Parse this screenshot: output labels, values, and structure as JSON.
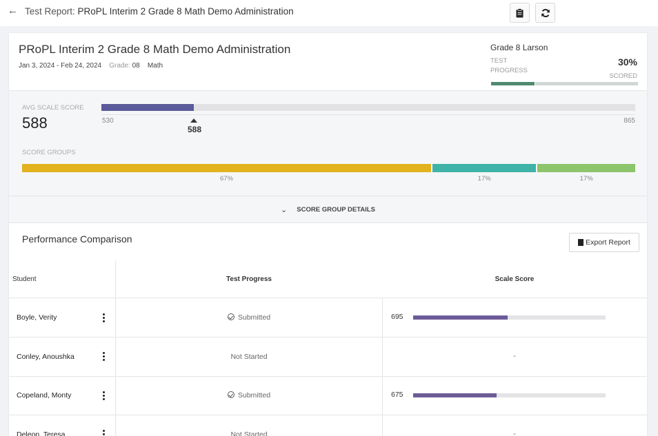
{
  "topbar": {
    "back_icon": "arrow-left-icon",
    "title_prefix": "Test Report:",
    "title_name": "PRoPL Interim 2 Grade 8 Math Demo Administration",
    "actions": [
      {
        "icon": "clipboard-icon"
      },
      {
        "icon": "refresh-icon"
      }
    ]
  },
  "header": {
    "title": "PRoPL Interim 2 Grade 8 Math Demo Administration",
    "date_range": "Jan 3, 2024 - Feb 24, 2024",
    "grade_label": "Grade:",
    "grade_value": "08",
    "subject": "Math",
    "group_name": "Grade 8 Larson",
    "progress_label_line1": "TEST",
    "progress_label_line2": "PROGRESS",
    "progress_percent": "30%",
    "progress_scored": "SCORED",
    "progress_segments": [
      0.3,
      0.7
    ],
    "progress_colors": [
      "#4f8a6e",
      "#cfd8d4"
    ]
  },
  "summary": {
    "avg_label": "AVG SCALE SCORE",
    "avg_value": "588",
    "scale_min": "530",
    "scale_max": "865",
    "scale_min_num": 530,
    "scale_max_num": 865,
    "scale_value_num": 588,
    "marker_value": "588",
    "bar_color": "#5b5a9a",
    "groups_label": "SCORE GROUPS",
    "groups": [
      {
        "percent": "67%",
        "share": 0.67,
        "color": "#e2b21f"
      },
      {
        "percent": "17%",
        "share": 0.17,
        "color": "#3fb3a7"
      },
      {
        "percent": "17%",
        "share": 0.16,
        "color": "#8cc56b"
      }
    ]
  },
  "details_toggle": {
    "icon": "chevron-down-icon",
    "label": "SCORE GROUP DETAILS"
  },
  "performance": {
    "title": "Performance Comparison",
    "export_icon": "file-icon",
    "export_label": "Export Report",
    "columns": {
      "student": "Student",
      "progress": "Test Progress",
      "score": "Scale Score"
    },
    "rows": [
      {
        "name": "Boyle, Verity",
        "status": "Submitted",
        "submitted": true,
        "score": "695",
        "score_num": 695
      },
      {
        "name": "Conley, Anoushka",
        "status": "Not Started",
        "submitted": false,
        "score": "-",
        "score_num": null
      },
      {
        "name": "Copeland, Monty",
        "status": "Submitted",
        "submitted": true,
        "score": "675",
        "score_num": 675
      },
      {
        "name": "Deleon, Teresa",
        "status": "Not Started",
        "submitted": false,
        "score": "-",
        "score_num": null
      }
    ]
  }
}
